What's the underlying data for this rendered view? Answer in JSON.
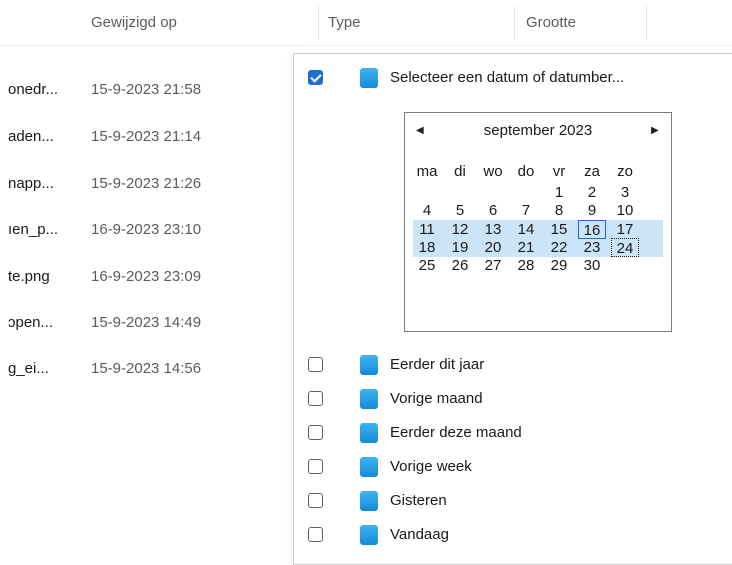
{
  "columns": {
    "modified": "Gewijzigd op",
    "type": "Type",
    "size": "Grootte"
  },
  "files": [
    {
      "name": "onedr...",
      "date": "15-9-2023 21:58"
    },
    {
      "name": "aden...",
      "date": "15-9-2023 21:14"
    },
    {
      "name": "napp...",
      "date": "15-9-2023 21:26"
    },
    {
      "name": "ıen_p...",
      "date": "16-9-2023 23:10"
    },
    {
      "name": "te.png",
      "date": "16-9-2023 23:09"
    },
    {
      "name": "ɔpen...",
      "date": "15-9-2023 14:49"
    },
    {
      "name": "g_ei...",
      "date": "15-9-2023 14:56"
    }
  ],
  "filter": {
    "date_range_label": "Selecteer een datum of datumber...",
    "date_range_checked": true,
    "options": [
      {
        "label": "Eerder dit jaar",
        "checked": false
      },
      {
        "label": "Vorige maand",
        "checked": false
      },
      {
        "label": "Eerder deze maand",
        "checked": false
      },
      {
        "label": "Vorige week",
        "checked": false
      },
      {
        "label": "Gisteren",
        "checked": false
      },
      {
        "label": "Vandaag",
        "checked": false
      }
    ]
  },
  "calendar": {
    "title": "september 2023",
    "prev_icon": "◀",
    "next_icon": "▶",
    "weekdays": [
      "ma",
      "di",
      "wo",
      "do",
      "vr",
      "za",
      "zo"
    ],
    "weeks": [
      [
        "",
        "",
        "",
        "",
        "1",
        "2",
        "3"
      ],
      [
        "4",
        "5",
        "6",
        "7",
        "8",
        "9",
        "10"
      ],
      [
        "11",
        "12",
        "13",
        "14",
        "15",
        "16",
        "17"
      ],
      [
        "18",
        "19",
        "20",
        "21",
        "22",
        "23",
        "24"
      ],
      [
        "25",
        "26",
        "27",
        "28",
        "29",
        "30",
        ""
      ]
    ],
    "highlighted_weeks": [
      2,
      3
    ],
    "today": "16",
    "focused": "24"
  },
  "colors": {
    "accent": "#1f6fcf",
    "highlight": "#cce4f7",
    "icon": "#1c96e3"
  }
}
